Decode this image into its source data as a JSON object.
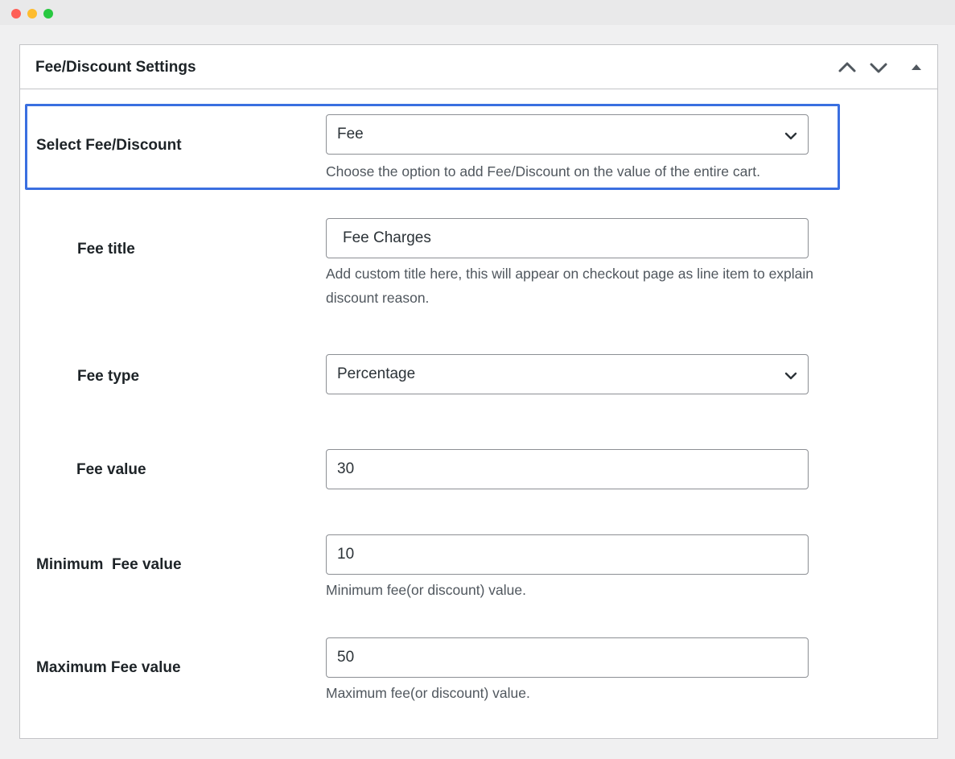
{
  "panel": {
    "title": "Fee/Discount Settings"
  },
  "header_icons": {
    "move_up": "chevron-up-icon",
    "move_down": "chevron-down-icon",
    "toggle": "triangle-up-icon"
  },
  "rows": {
    "select_type": {
      "label": "Select Fee/Discount",
      "value": "Fee",
      "description": "Choose the option to add Fee/Discount on the value of the entire cart."
    },
    "fee_title": {
      "label": "Fee title",
      "value": "Fee Charges",
      "description_line1": "Add custom title here, this will appear on checkout page as line item to explain",
      "description_line2": "discount reason."
    },
    "fee_type": {
      "label": "Fee type",
      "value": "Percentage"
    },
    "fee_value": {
      "label": "Fee value",
      "value": "30"
    },
    "min_fee": {
      "label": "Minimum  Fee value",
      "value": "10",
      "description": "Minimum fee(or discount) value."
    },
    "max_fee": {
      "label": "Maximum Fee value",
      "value": "50",
      "description": "Maximum fee(or discount) value."
    }
  },
  "colors": {
    "highlight": "#3a6fe0",
    "border": "#c3c4c7",
    "input_border": "#8c8f94"
  }
}
